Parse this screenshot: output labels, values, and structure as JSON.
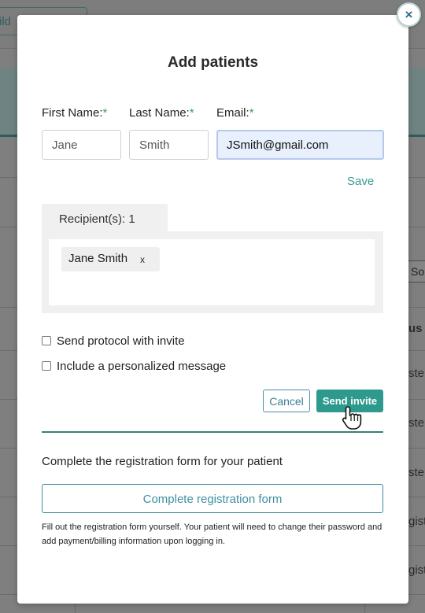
{
  "background": {
    "button_fragment": "ild",
    "sort_fragment": "So",
    "column_header_fragment": "us",
    "row_fragments": [
      "ste",
      "ste",
      "ste",
      "gist",
      "gist"
    ]
  },
  "modal": {
    "close_icon": "×",
    "title": "Add patients",
    "fields": {
      "first_name": {
        "label": "First Name:",
        "value": "Jane"
      },
      "last_name": {
        "label": "Last Name:",
        "value": "Smith"
      },
      "email": {
        "label": "Email:",
        "value": "JSmith@gmail.com"
      },
      "required_marker": "*"
    },
    "save_label": "Save",
    "recipients": {
      "tab_label": "Recipient(s): 1",
      "chips": [
        {
          "name": "Jane Smith",
          "remove": "x"
        }
      ]
    },
    "options": {
      "send_protocol": "Send protocol with invite",
      "personal_message": "Include a personalized message"
    },
    "cancel_label": "Cancel",
    "send_label": "Send invite",
    "registration": {
      "heading": "Complete the registration form for your patient",
      "button_label": "Complete registration form",
      "note": "Fill out the registration form yourself. Your patient will need to change their password and add payment/billing information upon logging in."
    }
  },
  "colors": {
    "accent": "#2e9a8d",
    "link": "#3a9b92",
    "required": "#3aa157",
    "focus_bg": "#e8f0fd"
  }
}
